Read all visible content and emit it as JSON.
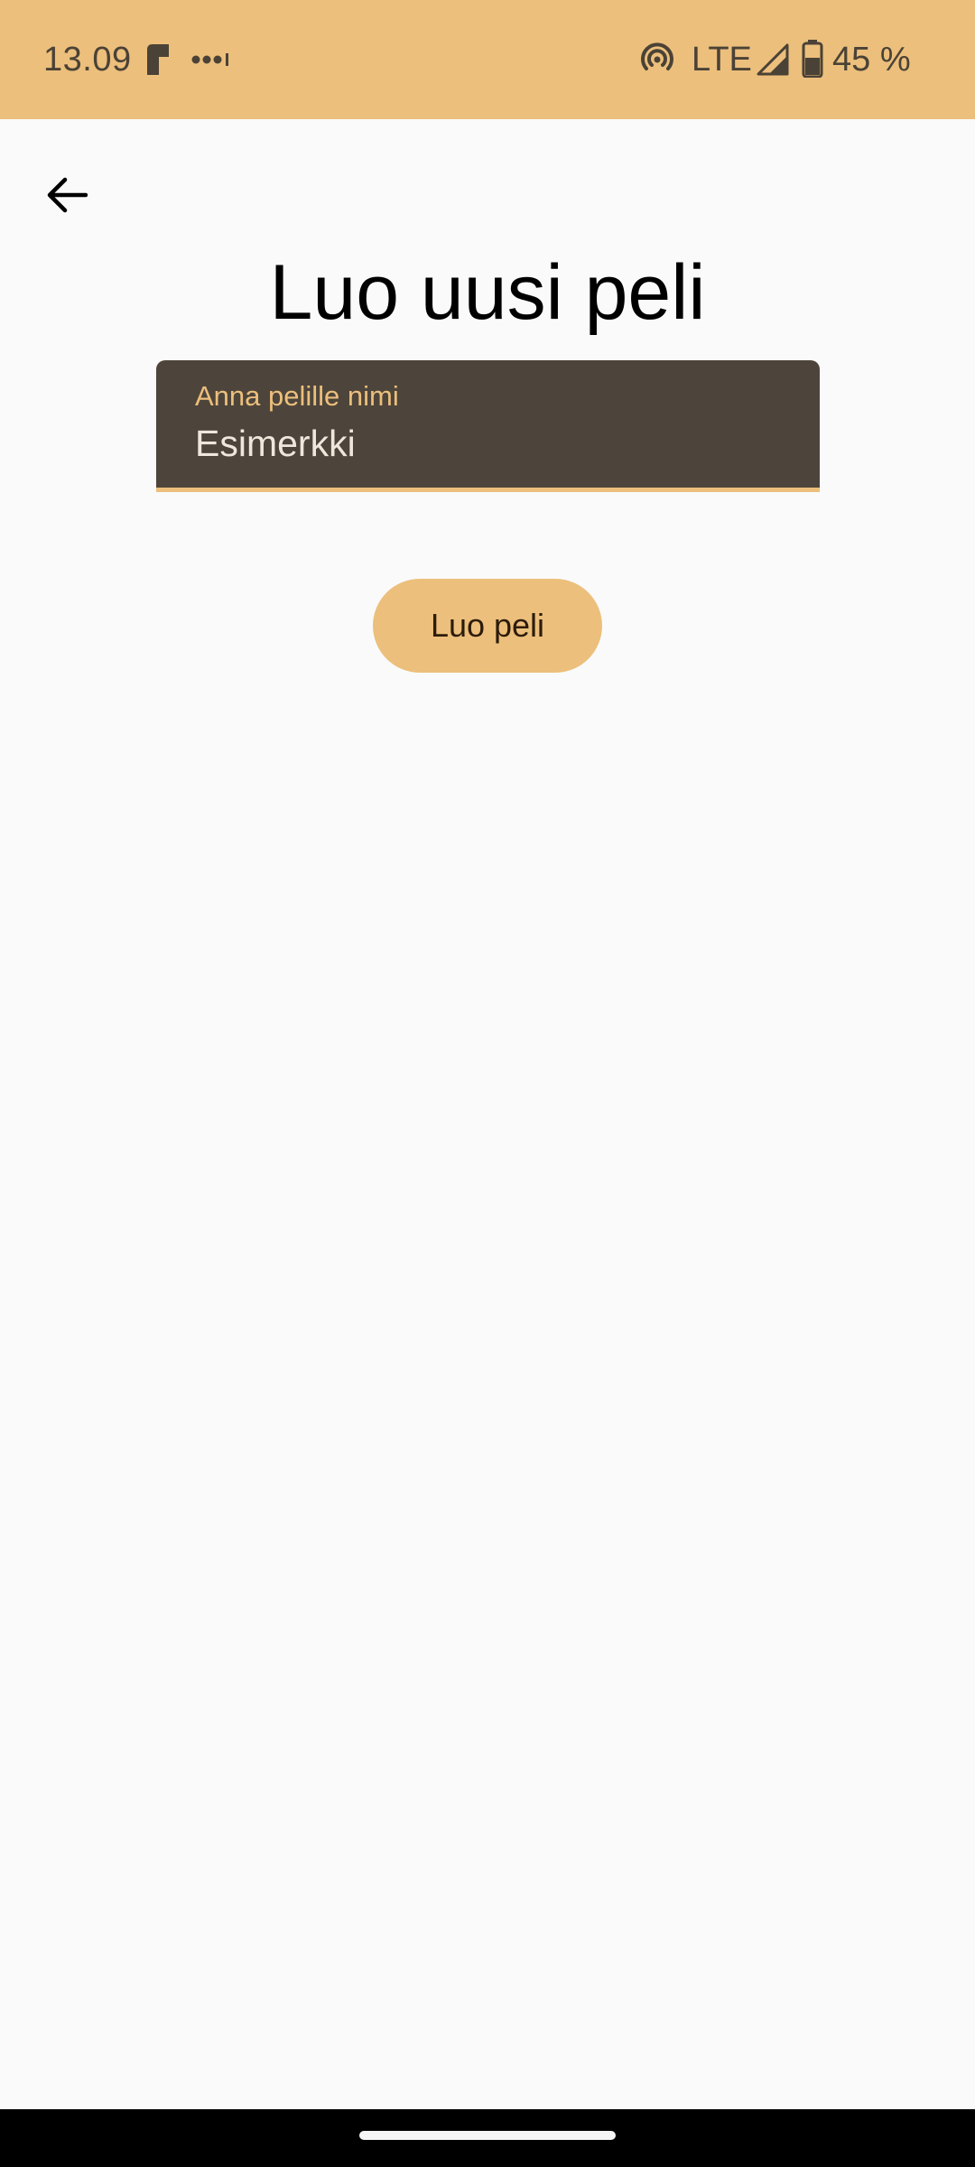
{
  "status_bar": {
    "time": "13.09",
    "network": "LTE",
    "battery": "45 %",
    "background": "#ecbf7c",
    "icons": [
      "app-notification-icon",
      "more-notifications-icon",
      "hotspot-icon",
      "cell-signal-icon",
      "battery-icon"
    ]
  },
  "header": {
    "back_icon": "arrow-back-icon",
    "title": "Luo uusi peli"
  },
  "form": {
    "name_field": {
      "label": "Anna pelille nimi",
      "value": "Esimerkki",
      "background": "#4d453b",
      "accent": "#ecbf7c"
    },
    "create_button_label": "Luo peli"
  },
  "colors": {
    "accent": "#ecbf7c",
    "page_background": "#fafafa",
    "nav_bar": "#000000"
  }
}
